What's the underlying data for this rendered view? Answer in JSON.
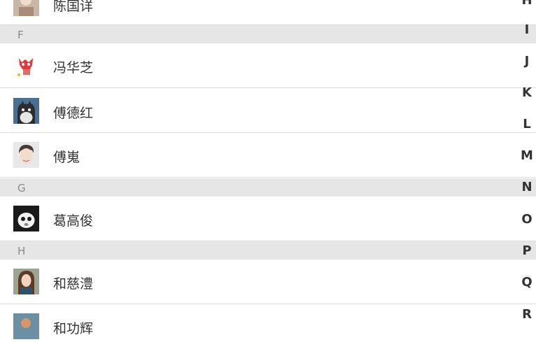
{
  "contacts": {
    "row0": {
      "name": "陈国详"
    },
    "sections": [
      {
        "letter": "F",
        "people": [
          "冯华芝",
          "傅德红",
          "傅嵬"
        ]
      },
      {
        "letter": "G",
        "people": [
          "葛高俊"
        ]
      },
      {
        "letter": "H",
        "people": [
          "和慈澧",
          "和功辉"
        ]
      }
    ]
  },
  "index_letters": [
    "H",
    "I",
    "J",
    "K",
    "L",
    "M",
    "N",
    "O",
    "P",
    "Q",
    "R"
  ],
  "colors": {
    "header_bg": "#e6e6e6",
    "divider": "#dcdcdc",
    "text": "#333333"
  }
}
